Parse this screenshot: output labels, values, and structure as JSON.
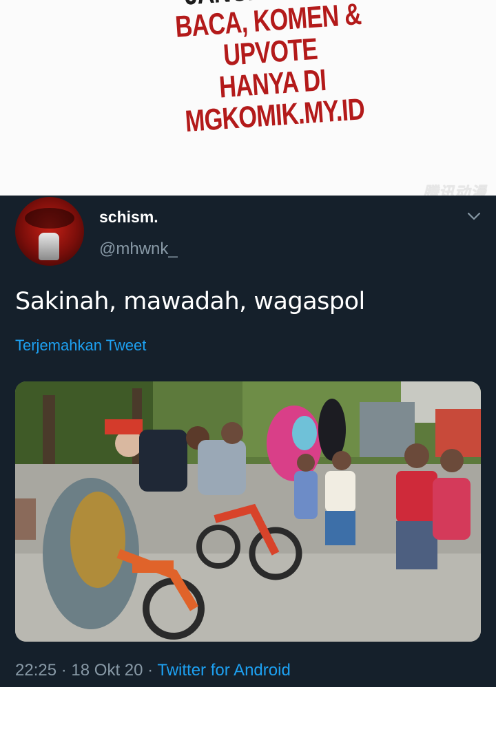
{
  "banner": {
    "line1": "JANGAN LUPA",
    "line2": "BACA, KOMEN & UPVOTE",
    "line3": "HANYA DI MGKOMIK.MY.ID",
    "watermark": "腾讯动漫",
    "colors": {
      "dark": "#1b1b1b",
      "red": "#b31a1a"
    }
  },
  "tweet": {
    "display_name": "schism.",
    "handle": "@mhwnk_",
    "text": "Sakinah, mawadah, wagaspol",
    "translate_link": "Terjemahkan Tweet",
    "time": "22:25",
    "separator": "·",
    "date": "18 Okt 20",
    "source": "Twitter for Android",
    "menu_icon": "chevron-down-icon",
    "colors": {
      "background": "#15202b",
      "link": "#1da1f2",
      "muted": "#8899a6"
    }
  }
}
